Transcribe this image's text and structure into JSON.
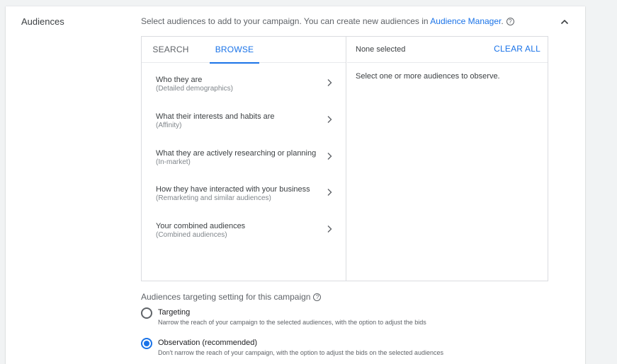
{
  "section": {
    "title": "Audiences",
    "description_prefix": "Select audiences to add to your campaign. You can create new audiences in ",
    "link_label": "Audience Manager",
    "description_suffix": ".",
    "help_icon": "?"
  },
  "picker": {
    "tabs": [
      {
        "label": "SEARCH"
      },
      {
        "label": "BROWSE"
      }
    ],
    "active_tab": "BROWSE",
    "categories": [
      {
        "title": "Who they are",
        "subtitle": "(Detailed demographics)"
      },
      {
        "title": "What their interests and habits are",
        "subtitle": "(Affinity)"
      },
      {
        "title": "What they are actively researching or planning",
        "subtitle": "(In-market)"
      },
      {
        "title": "How they have interacted with your business",
        "subtitle": "(Remarketing and similar audiences)"
      },
      {
        "title": "Your combined audiences",
        "subtitle": "(Combined audiences)"
      }
    ],
    "selected_header": "None selected",
    "clear_all_label": "CLEAR ALL",
    "empty_message": "Select one or more audiences to observe."
  },
  "targeting": {
    "label": "Audiences targeting setting for this campaign",
    "options": [
      {
        "title": "Targeting",
        "description": "Narrow the reach of your campaign to the selected audiences, with the option to adjust the bids",
        "checked": false
      },
      {
        "title": "Observation (recommended)",
        "description": "Don't narrow the reach of your campaign, with the option to adjust the bids on the selected audiences",
        "checked": true
      }
    ]
  },
  "colors": {
    "accent": "#1a73e8",
    "background": "#f1f3f4",
    "card": "#ffffff"
  }
}
